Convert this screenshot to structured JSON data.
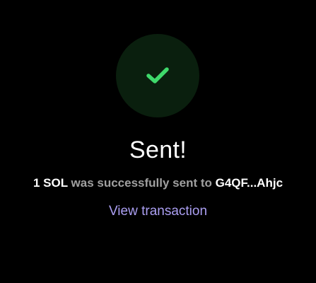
{
  "status": {
    "icon": "checkmark-icon",
    "icon_color": "#3fd96b",
    "circle_color": "#0a1f0e",
    "title": "Sent!"
  },
  "message": {
    "amount": "1 SOL",
    "text": " was successfully sent to ",
    "recipient": "G4QF...Ahjc"
  },
  "actions": {
    "view_transaction_label": "View transaction",
    "link_color": "#ab9ff2"
  }
}
